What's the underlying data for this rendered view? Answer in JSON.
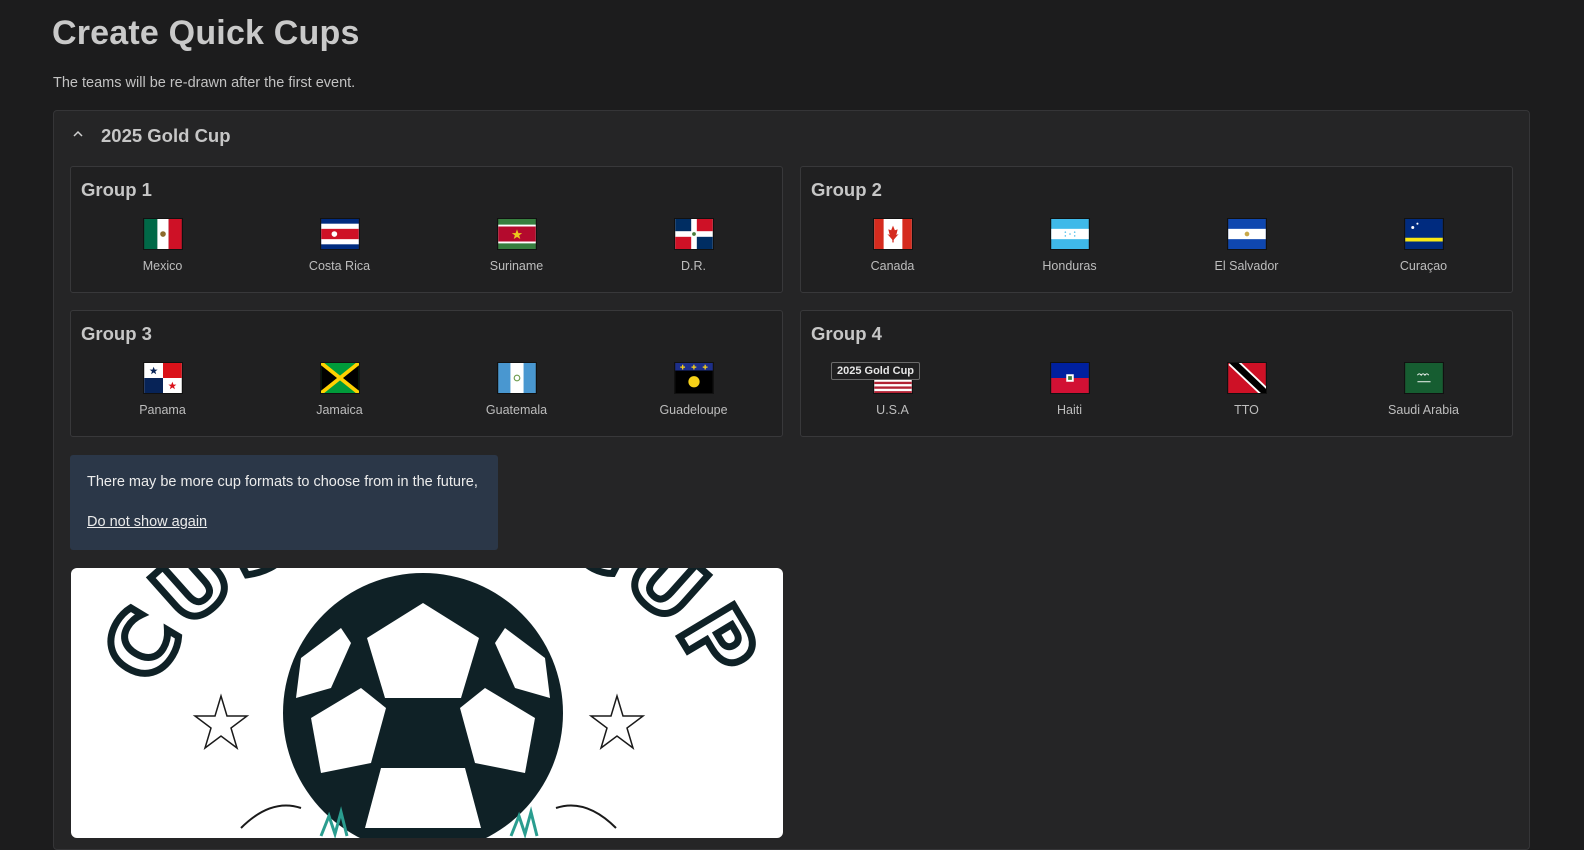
{
  "page": {
    "title": "Create Quick Cups",
    "subtitle": "The teams will be re-drawn after the first event."
  },
  "cup": {
    "name": "2025 Gold Cup",
    "expanded": true,
    "groups": [
      {
        "title": "Group 1",
        "teams": [
          "Mexico",
          "Costa Rica",
          "Suriname",
          "D.R."
        ]
      },
      {
        "title": "Group 2",
        "teams": [
          "Canada",
          "Honduras",
          "El Salvador",
          "Curaçao"
        ]
      },
      {
        "title": "Group 3",
        "teams": [
          "Panama",
          "Jamaica",
          "Guatemala",
          "Guadeloupe"
        ]
      },
      {
        "title": "Group 4",
        "teams": [
          "U.S.A",
          "Haiti",
          "TTO",
          "Saudi Arabia"
        ]
      }
    ]
  },
  "tooltip": {
    "text": "2025 Gold Cup"
  },
  "notice": {
    "text": "There may be more cup formats to choose from in the future,",
    "dismiss_label": "Do not show again"
  },
  "logo": {
    "text": "CUSTOM CUP",
    "icon": "soccer-ball-logo"
  },
  "colors": {
    "background": "#1c1c1d",
    "panel": "#252526",
    "notice": "#2b3748"
  }
}
